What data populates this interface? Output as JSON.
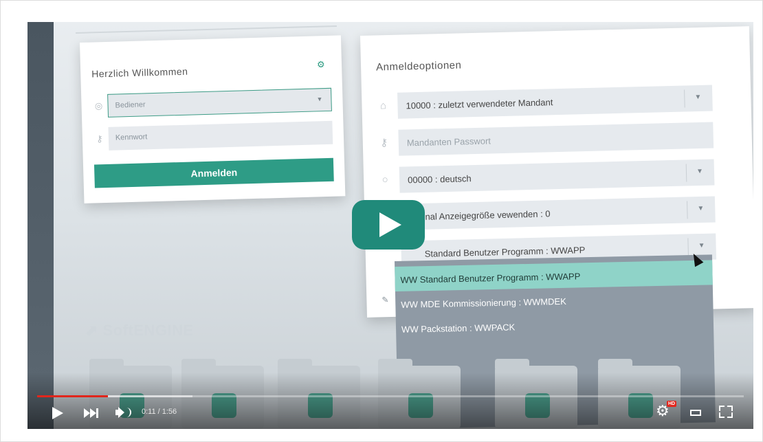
{
  "login": {
    "title": "Herzlich Willkommen",
    "user_placeholder": "Bediener",
    "password_placeholder": "Kennwort",
    "login_button": "Anmelden"
  },
  "options": {
    "title": "Anmeldeoptionen",
    "client": "10000 : zuletzt verwendeter Mandant",
    "client_password_placeholder": "Mandanten Passwort",
    "language": "00000 : deutsch",
    "display_size": "nal Anzeigegröße vewenden : 0",
    "program": "Standard Benutzer Programm : WWAPP"
  },
  "dropdown": {
    "items": [
      "WW Standard Benutzer Programm : WWAPP",
      "WW MDE Kommissionierung : WWMDEK",
      "WW Packstation : WWPACK"
    ],
    "selected_index": 0
  },
  "brand": "SoftENGINE",
  "player": {
    "time": "0:11 / 1:56",
    "progress_played": 0.1,
    "progress_loaded": 0.22,
    "hd_badge": "HD",
    "accent": "#e1261c",
    "play_button_color": "#208a7a"
  }
}
